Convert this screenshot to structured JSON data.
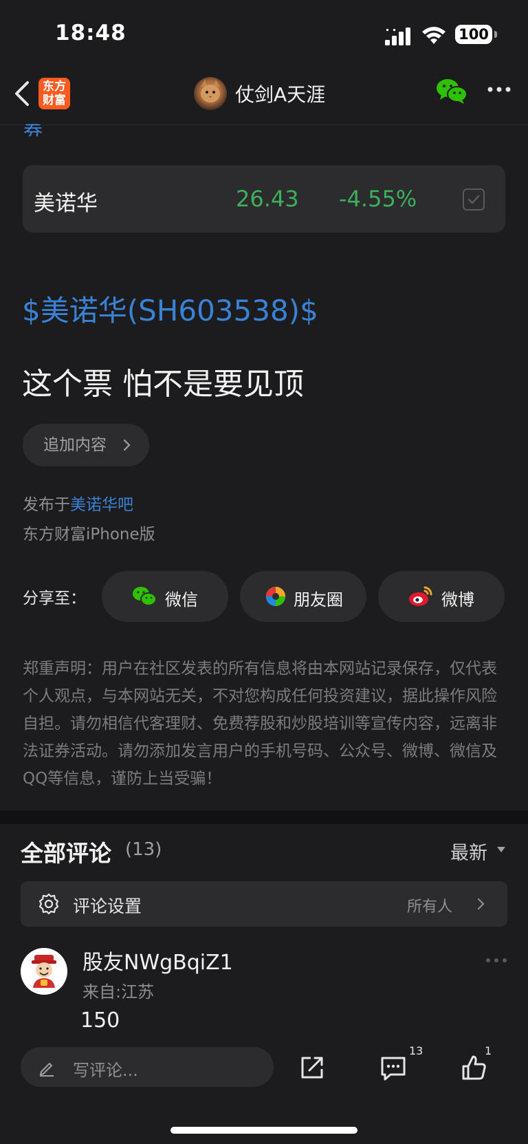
{
  "status_bar": {
    "time": "18:48",
    "battery": "100"
  },
  "nav": {
    "logo_line1": "东方",
    "logo_line2": "财富",
    "title": "仗剑A天涯"
  },
  "cut_text": "券",
  "stock": {
    "name": "美诺华",
    "price": "26.43",
    "change": "-4.55%"
  },
  "post": {
    "tag": "$美诺华(SH603538)$",
    "text": "这个票 怕不是要见顶"
  },
  "add_content": {
    "label": "追加内容"
  },
  "meta": {
    "published_prefix": "发布于",
    "published_bar": "美诺华吧",
    "device": "东方财富iPhone版"
  },
  "share": {
    "label": "分享至：",
    "wechat": "微信",
    "moments": "朋友圈",
    "weibo": "微博"
  },
  "disclaimer": "郑重声明：用户在社区发表的所有信息将由本网站记录保存，仅代表个人观点，与本网站无关，不对您构成任何投资建议，据此操作风险自担。请勿相信代客理财、免费荐股和炒股培训等宣传内容，远离非法证券活动。请勿添加发言用户的手机号码、公众号、微博、微信及QQ等信息，谨防上当受骗！",
  "comments": {
    "title": "全部评论",
    "count": "(13)",
    "sort": "最新",
    "settings_label": "评论设置",
    "settings_value": "所有人",
    "items": [
      {
        "user": "股友NWgBqiZ1",
        "from": "来自:江苏",
        "text": "150"
      }
    ]
  },
  "bottom": {
    "placeholder": "写评论...",
    "comment_count": "13",
    "like_count": "1"
  },
  "colors": {
    "background": "#1c1c1e",
    "card": "#2c2c2e",
    "link_blue": "#3a82d6",
    "down_green": "#3cb05a",
    "brand_orange": "#ff5a1f"
  }
}
